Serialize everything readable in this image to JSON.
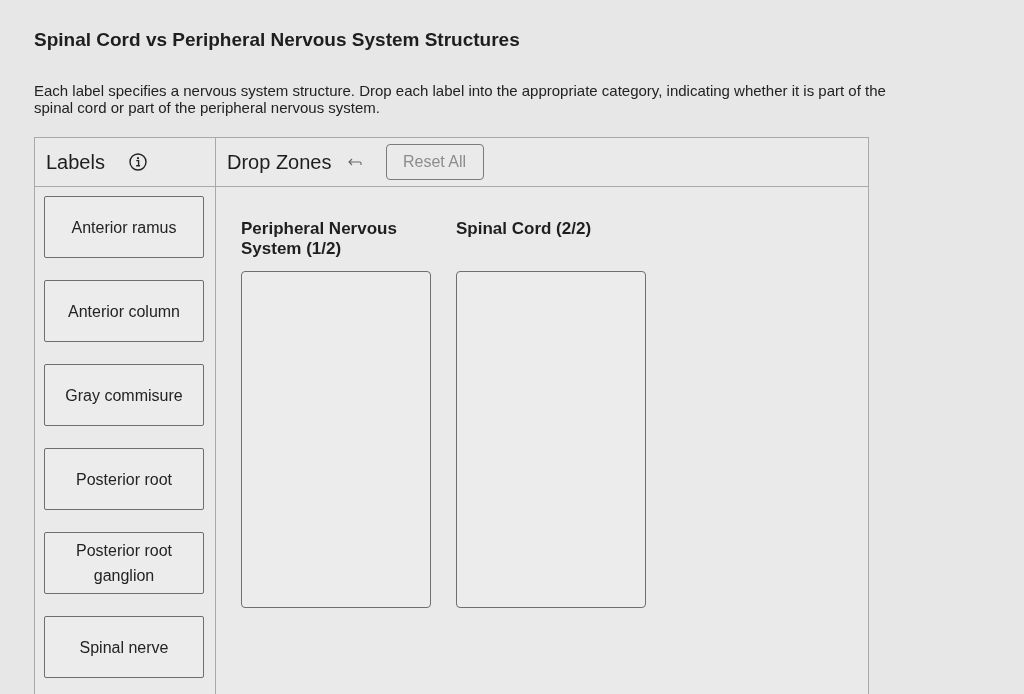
{
  "title": "Spinal Cord vs Peripheral Nervous System Structures",
  "instructions": "Each label specifies a nervous system structure. Drop each label into the appropriate category, indicating whether it is part of the spinal cord or part of the peripheral nervous system.",
  "labels_panel": {
    "heading": "Labels",
    "items": [
      "Anterior ramus",
      "Anterior column",
      "Gray commisure",
      "Posterior root",
      "Posterior root ganglion",
      "Spinal nerve"
    ]
  },
  "drop_zones": {
    "heading": "Drop Zones",
    "reset_button": {
      "label": "Reset All",
      "disabled": true
    },
    "zones": [
      {
        "title": "Peripheral Nervous System (1/2)"
      },
      {
        "title": "Spinal Cord (2/2)"
      }
    ]
  }
}
